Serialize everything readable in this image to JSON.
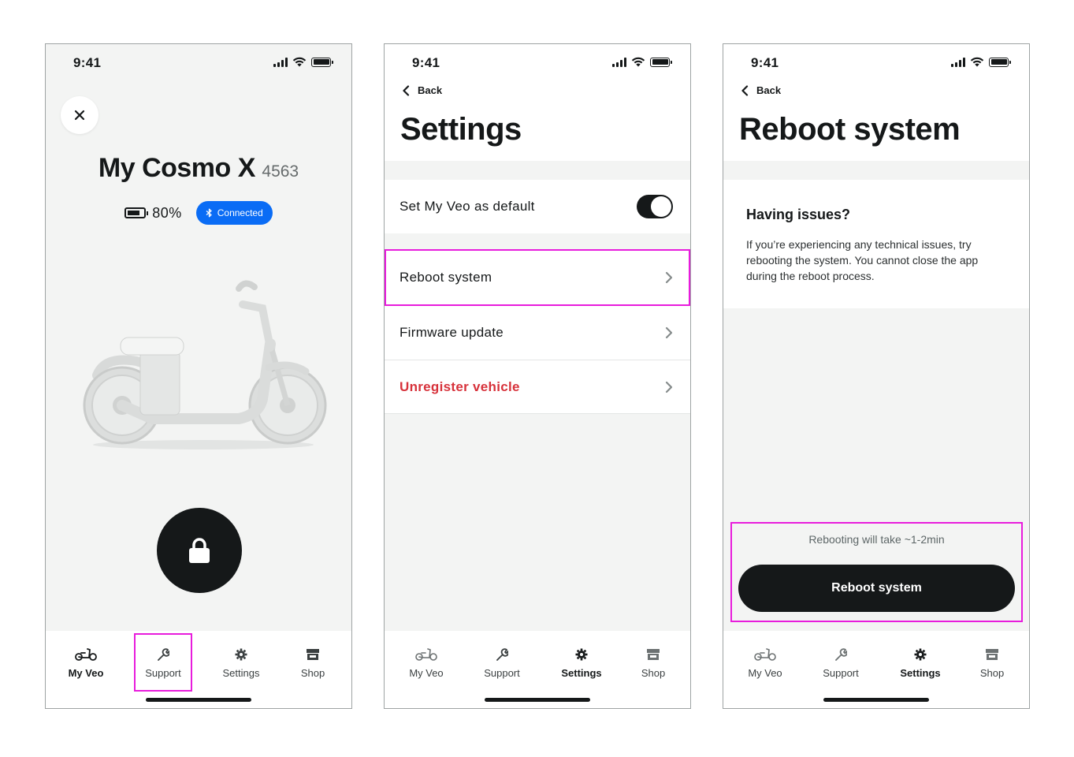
{
  "status": {
    "time": "9:41"
  },
  "colors": {
    "highlight": "#e81cdc",
    "connected": "#0a6cf5",
    "danger": "#d7323b",
    "primary": "#151819"
  },
  "vehicle": {
    "name": "My Cosmo X",
    "number": "4563",
    "battery": "80%",
    "battery_level": 0.8,
    "connection": "Connected",
    "lock_state": "locked"
  },
  "tabs": [
    {
      "label": "My Veo",
      "icon": "scooter-icon"
    },
    {
      "label": "Support",
      "icon": "wrench-icon"
    },
    {
      "label": "Settings",
      "icon": "gear-icon"
    },
    {
      "label": "Shop",
      "icon": "store-icon"
    }
  ],
  "settings": {
    "back_label": "Back",
    "title": "Settings",
    "default_toggle_label": "Set My Veo as default",
    "default_toggle_on": true,
    "items": [
      {
        "label": "Reboot system"
      },
      {
        "label": "Firmware update"
      },
      {
        "label": "Unregister vehicle"
      }
    ]
  },
  "reboot": {
    "back_label": "Back",
    "title": "Reboot system",
    "heading": "Having issues?",
    "body": "If you’re experiencing any technical issues, try rebooting the system. You cannot close the app during the reboot process.",
    "note": "Rebooting will take ~1-2min",
    "button": "Reboot system"
  }
}
